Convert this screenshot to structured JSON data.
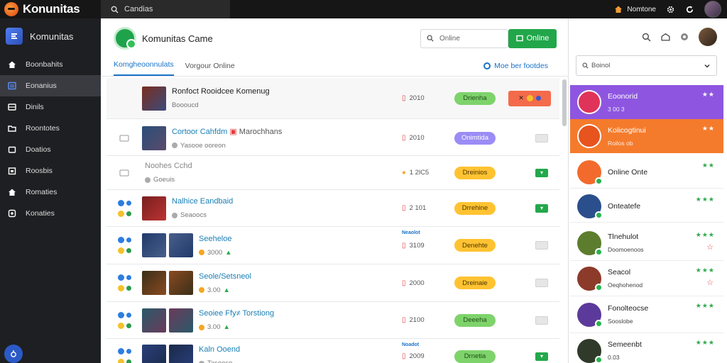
{
  "topbar": {
    "brand": "Konunitas",
    "search_text": "Candias",
    "user_name": "Nomtone"
  },
  "sidebar": {
    "title": "Komunitas",
    "items": [
      {
        "label": "Boonbahits",
        "icon": "home-icon",
        "active": false
      },
      {
        "label": "Eonanius",
        "icon": "list-icon",
        "active": true
      },
      {
        "label": "Dinils",
        "icon": "inbox-icon",
        "active": false
      },
      {
        "label": "Roontotes",
        "icon": "folder-icon",
        "active": false
      },
      {
        "label": "Doatios",
        "icon": "document-icon",
        "active": false
      },
      {
        "label": "Roosbis",
        "icon": "calendar-icon",
        "active": false
      },
      {
        "label": "Romaties",
        "icon": "home-icon",
        "active": false
      },
      {
        "label": "Konaties",
        "icon": "settings-icon",
        "active": false
      }
    ]
  },
  "main": {
    "title": "Komunitas Came",
    "search_placeholder": "Online",
    "online_button": "Online",
    "tabs": [
      {
        "label": "Komgheoonnulats",
        "active": true
      },
      {
        "label": "Vorgour Online",
        "active": false
      }
    ],
    "tab_link": "Moe ber footdes",
    "rows": [
      {
        "title": "Ronfoct Rooidcee Komenug",
        "sub": "Boooucd",
        "count": "2010",
        "status": "Drienha",
        "status_color": "green",
        "action": "big",
        "title_style": "dark"
      },
      {
        "title": "Cortoor Cahfdm",
        "title2": "Marochhans",
        "sub": "Yasooe ooreon",
        "count": "2010",
        "status": "Onimtida",
        "status_color": "purple",
        "action": "gray",
        "title_style": "link"
      },
      {
        "title": "Noohes Cchd",
        "sub": "Goeuis",
        "count": "1 2lC5",
        "status": "Dreinios",
        "status_color": "yellow",
        "action": "green",
        "title_style": "muted"
      },
      {
        "title": "Nalhice Eandbaid",
        "sub": "Seaoocs",
        "count": "2 101",
        "status": "Drrehine",
        "status_color": "yellow",
        "action": "green",
        "title_style": "link"
      },
      {
        "title": "Seeheloe",
        "sub": "3000",
        "count": "3109",
        "count_tag": "Neaolot",
        "status": "Denehte",
        "status_color": "yellow",
        "action": "gray",
        "title_style": "link"
      },
      {
        "title": "Seole/Setsneol",
        "sub": "3.00",
        "count": "2000",
        "status": "Dreinaie",
        "status_color": "yellow",
        "action": "gray",
        "title_style": "link"
      },
      {
        "title": "Seoiee Ffy≠ Torstiong",
        "sub": "3.00",
        "count": "2100",
        "status": "Deeeha",
        "status_color": "green",
        "action": "gray",
        "title_style": "link"
      },
      {
        "title": "Kaln Ooend",
        "sub": "Tasoose",
        "count": "2009",
        "count_tag": "Noadot",
        "status": "Drnetia",
        "status_color": "green",
        "action": "green",
        "title_style": "link"
      }
    ]
  },
  "right": {
    "select_text": "Boinol",
    "items": [
      {
        "name": "Eoonorid",
        "sub": "3 00 3",
        "stars": "★★",
        "style": "purple",
        "avatar": "#e0335a"
      },
      {
        "name": "Kolicogtinui",
        "sub": "Roilos ob",
        "stars": "★★",
        "style": "orange",
        "avatar": "#e8541d"
      },
      {
        "name": "Online Onte",
        "sub": "",
        "stars": "★★",
        "style": "plain",
        "avatar": "#f36b2c"
      },
      {
        "name": "Onteatefe",
        "sub": "",
        "stars": "★★★",
        "style": "plain",
        "avatar": "#2a4f8c"
      },
      {
        "name": "Tlnehulot",
        "sub": "Doomoenoos",
        "stars": "★★★",
        "style": "plain",
        "avatar": "#5c7d2e",
        "star2": "☆"
      },
      {
        "name": "Seacol",
        "sub": "Oeqhohenod",
        "stars": "★★★",
        "style": "plain",
        "avatar": "#8c3a2a",
        "star2": "☆"
      },
      {
        "name": "Fonolteocse",
        "sub": "Sooslobe",
        "stars": "★★★",
        "style": "plain",
        "avatar": "#5b3a9c"
      },
      {
        "name": "Semeenbt",
        "sub": "0.03",
        "stars": "★★★",
        "style": "plain",
        "avatar": "#2f3a2a"
      }
    ]
  },
  "colors": {
    "accent_blue": "#1a73c8",
    "online_green": "#22a64a",
    "highlight_purple": "#8e56e0",
    "highlight_orange": "#f57b2c"
  }
}
